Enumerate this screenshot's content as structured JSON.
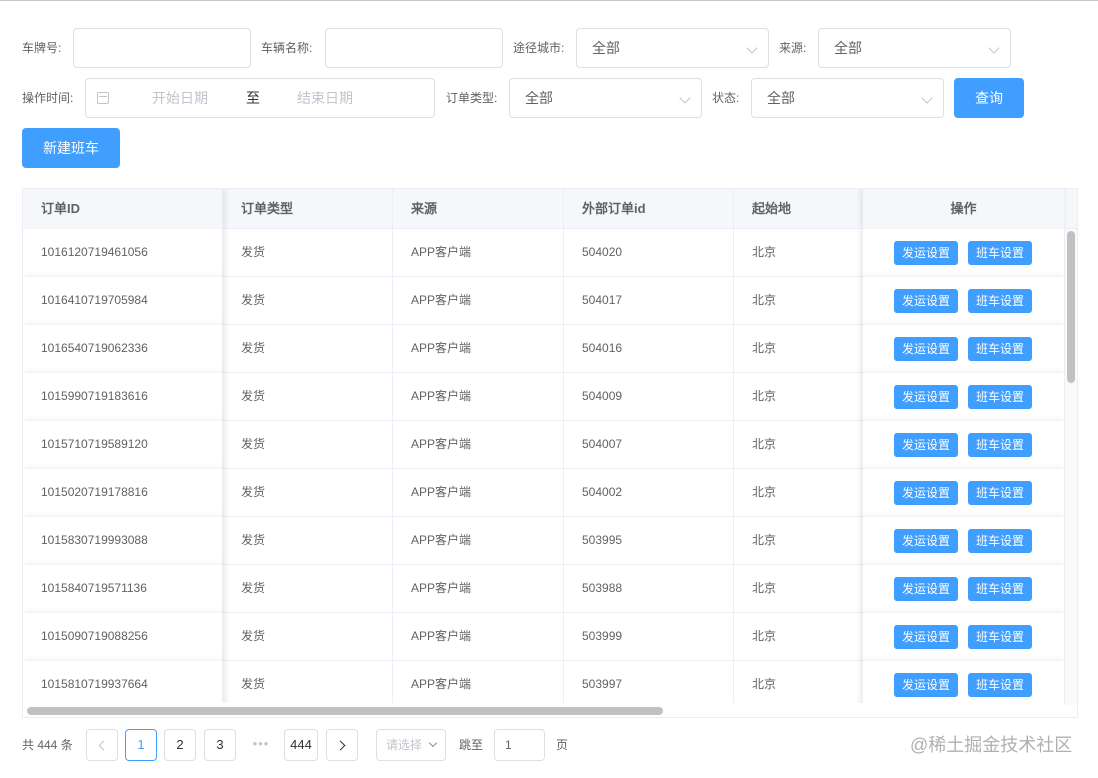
{
  "filters": {
    "plate_label": "车牌号:",
    "plate_value": "",
    "vehicle_name_label": "车辆名称:",
    "vehicle_name_value": "",
    "via_city_label": "途径城市:",
    "via_city_value": "全部",
    "source_label": "来源:",
    "source_value": "全部",
    "op_time_label": "操作时间:",
    "start_placeholder": "开始日期",
    "range_separator": "至",
    "end_placeholder": "结束日期",
    "order_type_label": "订单类型:",
    "order_type_value": "全部",
    "status_label": "状态:",
    "status_value": "全部",
    "query_button": "查询"
  },
  "new_bus_button": "新建班车",
  "table": {
    "headers": [
      "订单ID",
      "订单类型",
      "来源",
      "外部订单id",
      "起始地",
      "操作"
    ],
    "action_labels": [
      "发运设置",
      "班车设置"
    ],
    "rows": [
      {
        "id": "1016120719461056",
        "type": "发货",
        "source": "APP客户端",
        "ext_id": "504020",
        "origin": "北京"
      },
      {
        "id": "1016410719705984",
        "type": "发货",
        "source": "APP客户端",
        "ext_id": "504017",
        "origin": "北京"
      },
      {
        "id": "1016540719062336",
        "type": "发货",
        "source": "APP客户端",
        "ext_id": "504016",
        "origin": "北京"
      },
      {
        "id": "1015990719183616",
        "type": "发货",
        "source": "APP客户端",
        "ext_id": "504009",
        "origin": "北京"
      },
      {
        "id": "1015710719589120",
        "type": "发货",
        "source": "APP客户端",
        "ext_id": "504007",
        "origin": "北京"
      },
      {
        "id": "1015020719178816",
        "type": "发货",
        "source": "APP客户端",
        "ext_id": "504002",
        "origin": "北京"
      },
      {
        "id": "1015830719993088",
        "type": "发货",
        "source": "APP客户端",
        "ext_id": "503995",
        "origin": "北京"
      },
      {
        "id": "1015840719571136",
        "type": "发货",
        "source": "APP客户端",
        "ext_id": "503988",
        "origin": "北京"
      },
      {
        "id": "1015090719088256",
        "type": "发货",
        "source": "APP客户端",
        "ext_id": "503999",
        "origin": "北京"
      },
      {
        "id": "1015810719937664",
        "type": "发货",
        "source": "APP客户端",
        "ext_id": "503997",
        "origin": "北京"
      }
    ]
  },
  "pagination": {
    "total_text": "共 444 条",
    "pages": [
      "1",
      "2",
      "3"
    ],
    "ellipsis": "•••",
    "last_page": "444",
    "current_page": "1",
    "page_size_placeholder": "请选择",
    "jump_label": "跳至",
    "jump_value": "1",
    "page_suffix": "页"
  },
  "watermark": "@稀土掘金技术社区",
  "icons": [
    "calendar-icon",
    "chevron-down-icon",
    "chevron-left-icon",
    "chevron-right-icon"
  ],
  "colors": {
    "primary": "#409eff",
    "border": "#dcdfe6",
    "header_bg": "#f5f7fa"
  }
}
